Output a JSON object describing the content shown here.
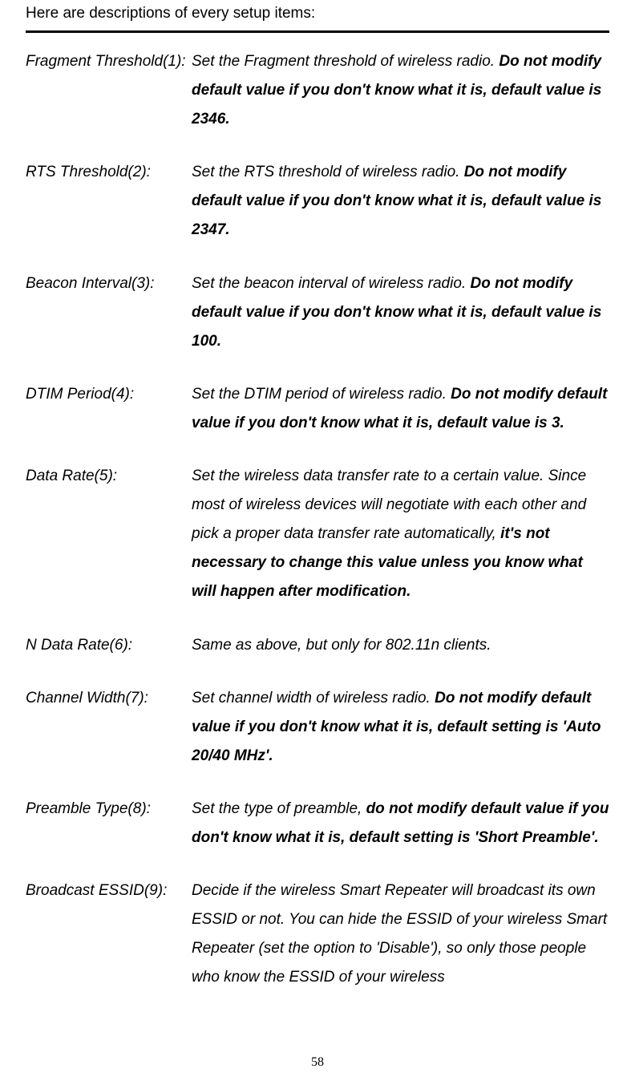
{
  "intro": "Here are descriptions of every setup items:",
  "rows": [
    {
      "label": "Fragment Threshold(1):",
      "segments": [
        {
          "t": "Set the Fragment threshold of wireless radio. ",
          "b": false
        },
        {
          "t": "Do not modify default value if you don't know what it is, default value is 2346.",
          "b": true
        }
      ]
    },
    {
      "label": "RTS Threshold(2):",
      "segments": [
        {
          "t": "Set the RTS threshold of wireless radio. ",
          "b": false
        },
        {
          "t": "Do not modify default value if you don't know what it is, default value is 2347.",
          "b": true
        }
      ]
    },
    {
      "label": "Beacon Interval(3):",
      "segments": [
        {
          "t": "Set the beacon interval of wireless radio. ",
          "b": false
        },
        {
          "t": "Do not modify default value if you don't know what it is, default value is 100.",
          "b": true
        }
      ]
    },
    {
      "label": "DTIM Period(4):",
      "segments": [
        {
          "t": "Set the DTIM period of wireless radio. ",
          "b": false
        },
        {
          "t": "Do not modify default value if you don't know what it is, default value is 3.",
          "b": true
        }
      ]
    },
    {
      "label": "Data Rate(5):",
      "segments": [
        {
          "t": "Set the wireless data transfer rate to a certain value. Since most of wireless devices will negotiate with each other and pick a proper data transfer rate automatically, ",
          "b": false
        },
        {
          "t": "it's not necessary to change this value unless you know what will happen after modification.",
          "b": true
        }
      ]
    },
    {
      "label": "N Data Rate(6):",
      "segments": [
        {
          "t": "Same as above, but only for 802.11n clients.",
          "b": false
        }
      ]
    },
    {
      "label": "Channel Width(7):",
      "segments": [
        {
          "t": "Set channel width of wireless radio. ",
          "b": false
        },
        {
          "t": "Do not modify default value if you don't know what it is, default setting is 'Auto 20/40 MHz'.",
          "b": true
        }
      ]
    },
    {
      "label": "Preamble Type(8):",
      "segments": [
        {
          "t": "Set the type of preamble, ",
          "b": false
        },
        {
          "t": "do not modify default value if you don't know what it is, default setting is 'Short Preamble'.",
          "b": true
        }
      ]
    },
    {
      "label": "Broadcast ESSID(9):",
      "segments": [
        {
          "t": "Decide if the wireless Smart Repeater will broadcast its own ESSID or not. You can hide the ESSID of your wireless Smart Repeater (set the option to 'Disable'), so only those people who know the ESSID of your wireless",
          "b": false
        }
      ]
    }
  ],
  "page_number": "58"
}
